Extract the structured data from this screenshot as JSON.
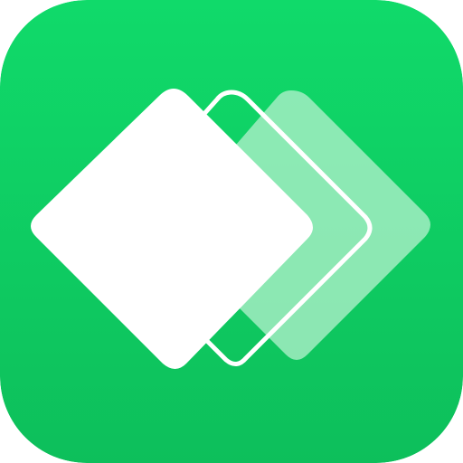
{
  "icon": {
    "semantic_name": "layered-diamonds-app-icon",
    "colors": {
      "background_top": "#10da6a",
      "background_bottom": "#0dbf5b",
      "front_diamond": "#ffffff",
      "middle_diamond_outline": "#ffffff",
      "back_diamond": "#b7f2cf",
      "back_diamond_opacity": "0.75"
    }
  }
}
